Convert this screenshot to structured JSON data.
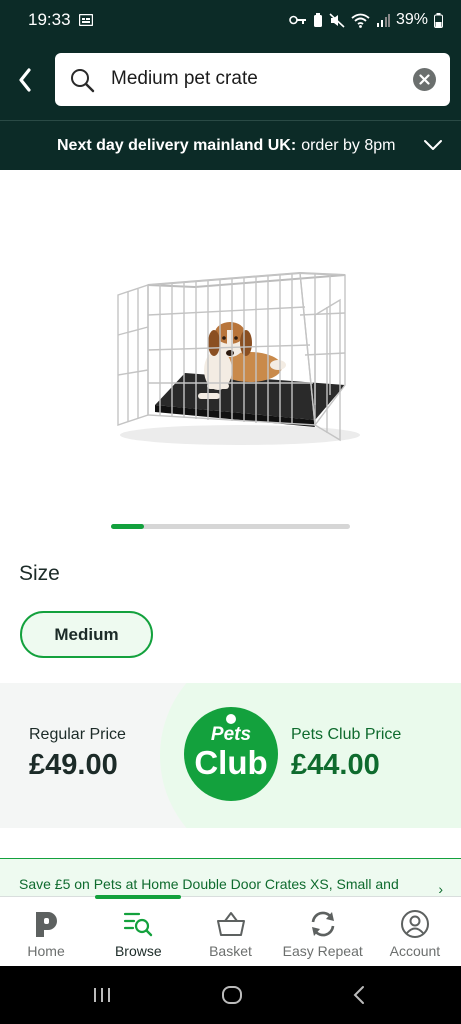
{
  "status_bar": {
    "time": "19:33",
    "battery": "39%"
  },
  "search": {
    "value": "Medium pet crate"
  },
  "delivery": {
    "bold": "Next day delivery mainland UK:",
    "text": "order by 8pm"
  },
  "carousel": {
    "current_index": 1,
    "progress": 0.14
  },
  "size": {
    "label": "Size",
    "selected": "Medium"
  },
  "pricing": {
    "regular_label": "Regular Price",
    "regular_price": "£49.00",
    "club_label": "Pets Club Price",
    "club_price": "£44.00",
    "logo_top": "Pets",
    "logo_bottom": "Club"
  },
  "promo": {
    "text": "Save £5 on Pets at Home Double Door Crates XS, Small and"
  },
  "nav": {
    "items": [
      {
        "label": "Home",
        "icon": "pets-at-home-logo-icon",
        "active": false
      },
      {
        "label": "Browse",
        "icon": "browse-search-icon",
        "active": true
      },
      {
        "label": "Basket",
        "icon": "basket-icon",
        "active": false
      },
      {
        "label": "Easy Repeat",
        "icon": "repeat-icon",
        "active": false
      },
      {
        "label": "Account",
        "icon": "account-icon",
        "active": false
      }
    ]
  },
  "colors": {
    "header_bg": "#0c2b27",
    "brand_green": "#13a13d",
    "club_text": "#0f6b2e"
  }
}
